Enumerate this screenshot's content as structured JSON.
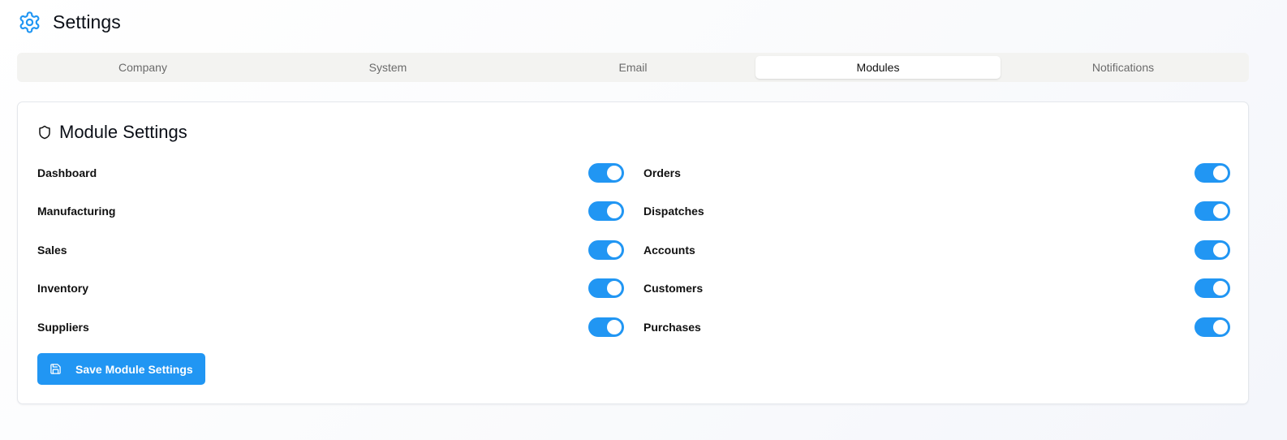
{
  "header": {
    "title": "Settings",
    "icon": "gear-icon",
    "icon_color": "#2196f3"
  },
  "tabs": [
    {
      "label": "Company",
      "active": false
    },
    {
      "label": "System",
      "active": false
    },
    {
      "label": "Email",
      "active": false
    },
    {
      "label": "Modules",
      "active": true
    },
    {
      "label": "Notifications",
      "active": false
    }
  ],
  "card": {
    "title": "Module Settings",
    "icon": "shield-icon",
    "modules_left": [
      {
        "label": "Dashboard",
        "enabled": true
      },
      {
        "label": "Manufacturing",
        "enabled": true
      },
      {
        "label": "Sales",
        "enabled": true
      },
      {
        "label": "Inventory",
        "enabled": true
      },
      {
        "label": "Suppliers",
        "enabled": true
      }
    ],
    "modules_right": [
      {
        "label": "Orders",
        "enabled": true
      },
      {
        "label": "Dispatches",
        "enabled": true
      },
      {
        "label": "Accounts",
        "enabled": true
      },
      {
        "label": "Customers",
        "enabled": true
      },
      {
        "label": "Purchases",
        "enabled": true
      }
    ],
    "save_label": "Save Module Settings",
    "save_icon": "save-icon"
  },
  "colors": {
    "accent": "#2196f3",
    "tab_bar": "#f3f3f1",
    "card_border": "#e4e7ec"
  }
}
